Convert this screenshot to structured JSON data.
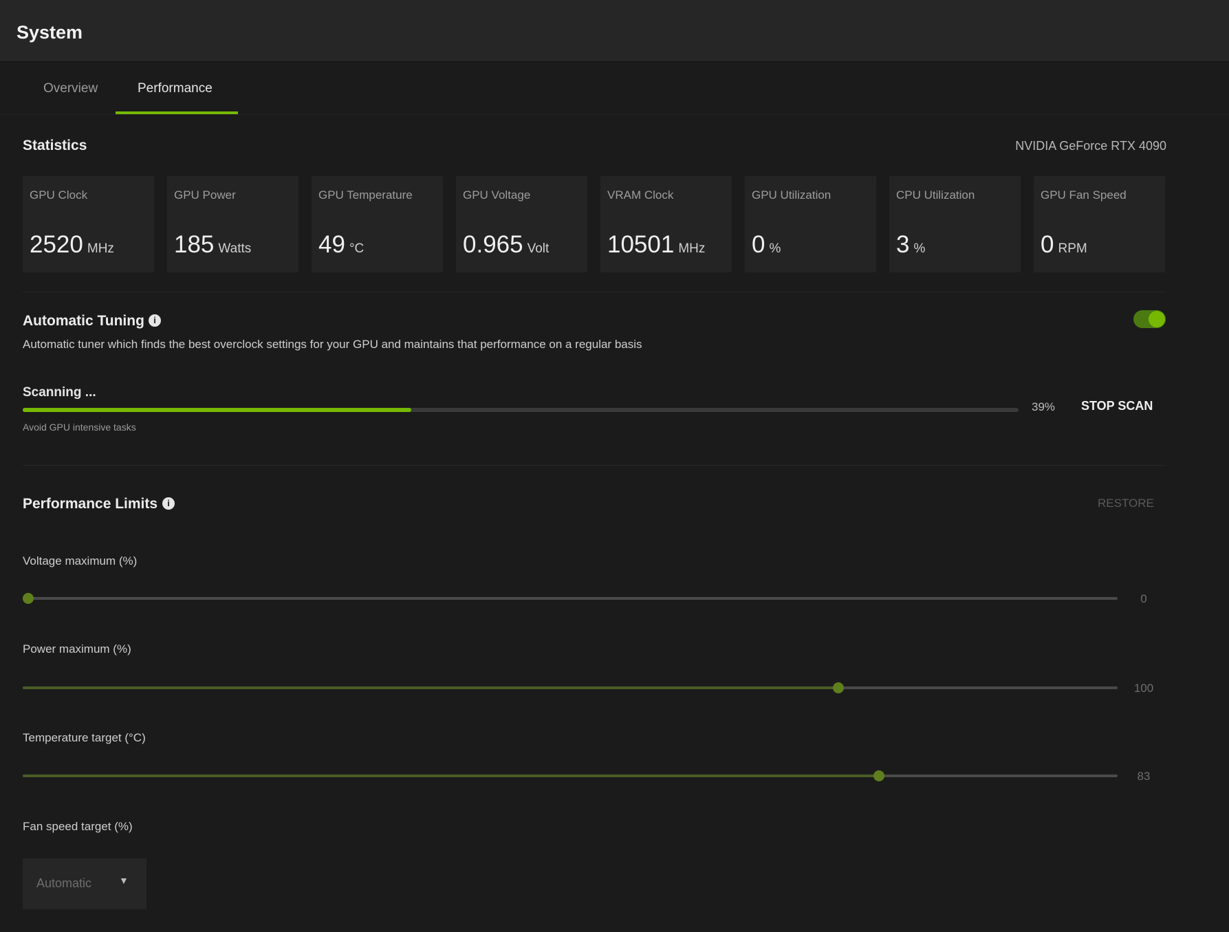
{
  "window": {
    "title": "System"
  },
  "tabs": [
    {
      "label": "Overview",
      "active": false
    },
    {
      "label": "Performance",
      "active": true
    }
  ],
  "statistics": {
    "title": "Statistics",
    "gpu_name": "NVIDIA GeForce RTX 4090",
    "cards": [
      {
        "label": "GPU Clock",
        "value": "2520",
        "unit": "MHz"
      },
      {
        "label": "GPU Power",
        "value": "185",
        "unit": "Watts"
      },
      {
        "label": "GPU Temperature",
        "value": "49",
        "unit": "°C"
      },
      {
        "label": "GPU Voltage",
        "value": "0.965",
        "unit": "Volt"
      },
      {
        "label": "VRAM Clock",
        "value": "10501",
        "unit": "MHz"
      },
      {
        "label": "GPU Utilization",
        "value": "0",
        "unit": "%"
      },
      {
        "label": "CPU Utilization",
        "value": "3",
        "unit": "%"
      },
      {
        "label": "GPU Fan Speed",
        "value": "0",
        "unit": "RPM"
      }
    ]
  },
  "automatic_tuning": {
    "title": "Automatic Tuning",
    "info_icon": "info-icon",
    "description": "Automatic tuner which finds the best overclock settings for your GPU and maintains that performance on a regular basis",
    "enabled": true,
    "accent_color": "#76b900",
    "scan": {
      "label": "Scanning ...",
      "progress": 0.39,
      "percent_label": "39%",
      "stop_label": "STOP SCAN",
      "hint": "Avoid GPU intensive tasks"
    }
  },
  "performance_limits": {
    "title": "Performance Limits",
    "info_icon": "info-icon",
    "restore_label": "RESTORE",
    "sliders": [
      {
        "label": "Voltage maximum (%)",
        "value": "0",
        "position": 0.0
      },
      {
        "label": "Power maximum (%)",
        "value": "100",
        "position": 0.745
      },
      {
        "label": "Temperature target (°C)",
        "value": "83",
        "position": 0.782
      }
    ],
    "fan_speed": {
      "label": "Fan speed target (%)",
      "selected": "Automatic",
      "chevron_icon": "chevron-down-icon"
    }
  }
}
